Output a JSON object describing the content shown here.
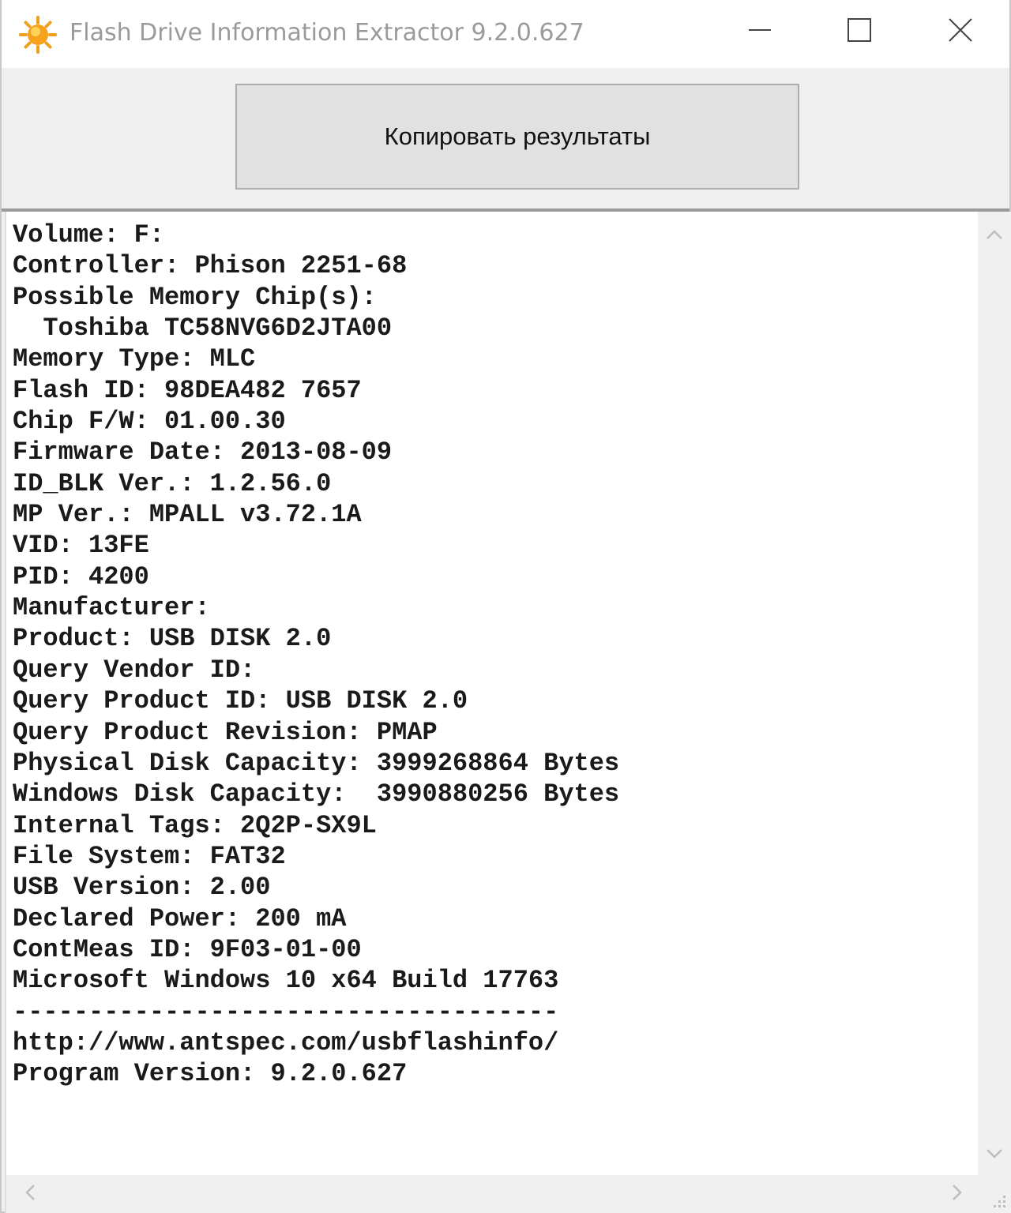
{
  "window": {
    "title": "Flash Drive Information Extractor 9.2.0.627",
    "icon": "sun-icon",
    "controls": [
      "minimize-icon",
      "maximize-icon",
      "close-icon"
    ]
  },
  "toolbar": {
    "copy_label": "Копировать результаты"
  },
  "report": {
    "lines": [
      "Volume: F:",
      "Controller: Phison 2251-68",
      "Possible Memory Chip(s):",
      "  Toshiba TC58NVG6D2JTA00",
      "Memory Type: MLC",
      "Flash ID: 98DEA482 7657",
      "Chip F/W: 01.00.30",
      "Firmware Date: 2013-08-09",
      "ID_BLK Ver.: 1.2.56.0",
      "MP Ver.: MPALL v3.72.1A",
      "VID: 13FE",
      "PID: 4200",
      "Manufacturer:",
      "Product: USB DISK 2.0",
      "Query Vendor ID:",
      "Query Product ID: USB DISK 2.0",
      "Query Product Revision: PMAP",
      "Physical Disk Capacity: 3999268864 Bytes",
      "Windows Disk Capacity:  3990880256 Bytes",
      "Internal Tags: 2Q2P-SX9L",
      "File System: FAT32",
      "USB Version: 2.00",
      "Declared Power: 200 mA",
      "ContMeas ID: 9F03-01-00",
      "Microsoft Windows 10 x64 Build 17763",
      "------------------------------------",
      "http://www.antspec.com/usbflashinfo/",
      "Program Version: 9.2.0.627"
    ]
  },
  "colors": {
    "title_text": "#9a9a9a",
    "button_face": "#e1e1e1",
    "chrome": "#f0f0f0",
    "icon_sun": "#f5a623"
  }
}
